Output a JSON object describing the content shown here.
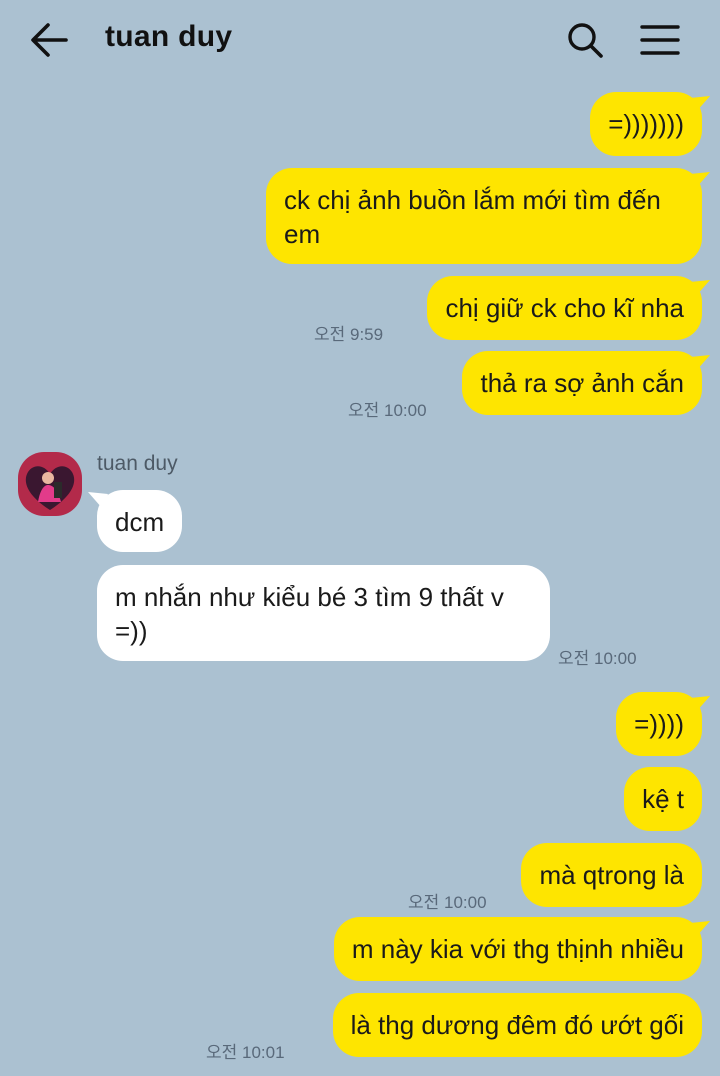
{
  "header": {
    "title": "tuan duy",
    "back_icon": "arrow-left-icon",
    "search_icon": "search-icon",
    "menu_icon": "hamburger-menu-icon"
  },
  "colors": {
    "background": "#abc1d1",
    "outgoing_bubble": "#fee500",
    "incoming_bubble": "#ffffff"
  },
  "sender_name": "tuan duy",
  "messages": [
    {
      "dir": "out",
      "text": "=)))))))"
    },
    {
      "dir": "out",
      "text": "ck chị ảnh buồn lắm mới tìm đến em"
    },
    {
      "dir": "out",
      "text": "chị giữ ck cho kĩ nha",
      "time": "오전 9:59"
    },
    {
      "dir": "out",
      "text": "thả ra sợ ảnh cắn",
      "time": "오전 10:00"
    },
    {
      "dir": "in",
      "text": "dcm"
    },
    {
      "dir": "in",
      "text": "m nhắn như kiểu bé 3 tìm 9 thất v =))",
      "time": "오전 10:00"
    },
    {
      "dir": "out",
      "text": "=))))"
    },
    {
      "dir": "out",
      "text": "kệ t"
    },
    {
      "dir": "out",
      "text": "mà qtrong là",
      "time": "오전 10:00"
    },
    {
      "dir": "out",
      "text": "m này kia với thg thịnh nhiều"
    },
    {
      "dir": "out",
      "text": "là thg dương đêm đó ướt gối",
      "time": "오전 10:01"
    }
  ]
}
